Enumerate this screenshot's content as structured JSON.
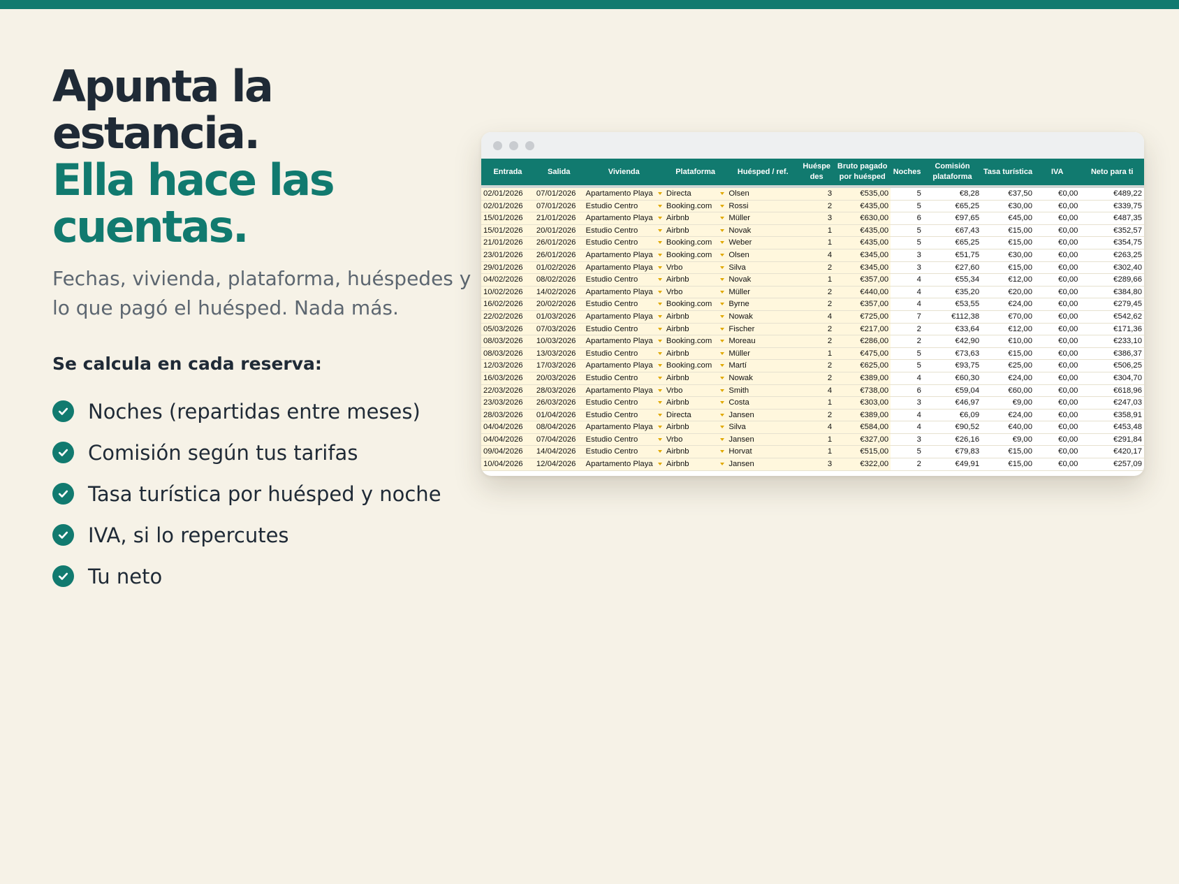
{
  "hero": {
    "title_line1": "Apunta la estancia.",
    "title_line2": "Ella hace las cuentas.",
    "subtitle": "Fechas, vivienda, plataforma, huéspedes y lo que pagó el huésped. Nada más.",
    "calc_title": "Se calcula en cada reserva:",
    "features": [
      "Noches (repartidas entre meses)",
      "Comisión según tus tarifas",
      "Tasa turística por huésped y noche",
      "IVA, si lo repercutes",
      "Tu neto"
    ]
  },
  "colors": {
    "accent": "#117a6f",
    "background": "#f6f2e7",
    "input_cell": "#fff7dd",
    "dropdown_arrow": "#e0a800"
  },
  "icons": {
    "feature_bullet": "check-circle-icon",
    "cell_dropdown": "dropdown-arrow-icon"
  },
  "sheet": {
    "headers": [
      "Entrada",
      "Salida",
      "Vivienda",
      "Plataforma",
      "Huésped / ref.",
      "Huéspe des",
      "Bruto pagado por huésped",
      "Noches",
      "Comisión plataforma",
      "Tasa turística",
      "IVA",
      "Neto para ti"
    ],
    "rows": [
      [
        "02/01/2026",
        "07/01/2026",
        "Apartamento Playa",
        "Directa",
        "Olsen",
        "3",
        "€535,00",
        "5",
        "€8,28",
        "€37,50",
        "€0,00",
        "€489,22"
      ],
      [
        "02/01/2026",
        "07/01/2026",
        "Estudio Centro",
        "Booking.com",
        "Rossi",
        "2",
        "€435,00",
        "5",
        "€65,25",
        "€30,00",
        "€0,00",
        "€339,75"
      ],
      [
        "15/01/2026",
        "21/01/2026",
        "Apartamento Playa",
        "Airbnb",
        "Müller",
        "3",
        "€630,00",
        "6",
        "€97,65",
        "€45,00",
        "€0,00",
        "€487,35"
      ],
      [
        "15/01/2026",
        "20/01/2026",
        "Estudio Centro",
        "Airbnb",
        "Novak",
        "1",
        "€435,00",
        "5",
        "€67,43",
        "€15,00",
        "€0,00",
        "€352,57"
      ],
      [
        "21/01/2026",
        "26/01/2026",
        "Estudio Centro",
        "Booking.com",
        "Weber",
        "1",
        "€435,00",
        "5",
        "€65,25",
        "€15,00",
        "€0,00",
        "€354,75"
      ],
      [
        "23/01/2026",
        "26/01/2026",
        "Apartamento Playa",
        "Booking.com",
        "Olsen",
        "4",
        "€345,00",
        "3",
        "€51,75",
        "€30,00",
        "€0,00",
        "€263,25"
      ],
      [
        "29/01/2026",
        "01/02/2026",
        "Apartamento Playa",
        "Vrbo",
        "Silva",
        "2",
        "€345,00",
        "3",
        "€27,60",
        "€15,00",
        "€0,00",
        "€302,40"
      ],
      [
        "04/02/2026",
        "08/02/2026",
        "Estudio Centro",
        "Airbnb",
        "Novak",
        "1",
        "€357,00",
        "4",
        "€55,34",
        "€12,00",
        "€0,00",
        "€289,66"
      ],
      [
        "10/02/2026",
        "14/02/2026",
        "Apartamento Playa",
        "Vrbo",
        "Müller",
        "2",
        "€440,00",
        "4",
        "€35,20",
        "€20,00",
        "€0,00",
        "€384,80"
      ],
      [
        "16/02/2026",
        "20/02/2026",
        "Estudio Centro",
        "Booking.com",
        "Byrne",
        "2",
        "€357,00",
        "4",
        "€53,55",
        "€24,00",
        "€0,00",
        "€279,45"
      ],
      [
        "22/02/2026",
        "01/03/2026",
        "Apartamento Playa",
        "Airbnb",
        "Nowak",
        "4",
        "€725,00",
        "7",
        "€112,38",
        "€70,00",
        "€0,00",
        "€542,62"
      ],
      [
        "05/03/2026",
        "07/03/2026",
        "Estudio Centro",
        "Airbnb",
        "Fischer",
        "2",
        "€217,00",
        "2",
        "€33,64",
        "€12,00",
        "€0,00",
        "€171,36"
      ],
      [
        "08/03/2026",
        "10/03/2026",
        "Apartamento Playa",
        "Booking.com",
        "Moreau",
        "2",
        "€286,00",
        "2",
        "€42,90",
        "€10,00",
        "€0,00",
        "€233,10"
      ],
      [
        "08/03/2026",
        "13/03/2026",
        "Estudio Centro",
        "Airbnb",
        "Müller",
        "1",
        "€475,00",
        "5",
        "€73,63",
        "€15,00",
        "€0,00",
        "€386,37"
      ],
      [
        "12/03/2026",
        "17/03/2026",
        "Apartamento Playa",
        "Booking.com",
        "Martí",
        "2",
        "€625,00",
        "5",
        "€93,75",
        "€25,00",
        "€0,00",
        "€506,25"
      ],
      [
        "16/03/2026",
        "20/03/2026",
        "Estudio Centro",
        "Airbnb",
        "Nowak",
        "2",
        "€389,00",
        "4",
        "€60,30",
        "€24,00",
        "€0,00",
        "€304,70"
      ],
      [
        "22/03/2026",
        "28/03/2026",
        "Apartamento Playa",
        "Vrbo",
        "Smith",
        "4",
        "€738,00",
        "6",
        "€59,04",
        "€60,00",
        "€0,00",
        "€618,96"
      ],
      [
        "23/03/2026",
        "26/03/2026",
        "Estudio Centro",
        "Airbnb",
        "Costa",
        "1",
        "€303,00",
        "3",
        "€46,97",
        "€9,00",
        "€0,00",
        "€247,03"
      ],
      [
        "28/03/2026",
        "01/04/2026",
        "Estudio Centro",
        "Directa",
        "Jansen",
        "2",
        "€389,00",
        "4",
        "€6,09",
        "€24,00",
        "€0,00",
        "€358,91"
      ],
      [
        "04/04/2026",
        "08/04/2026",
        "Apartamento Playa",
        "Airbnb",
        "Silva",
        "4",
        "€584,00",
        "4",
        "€90,52",
        "€40,00",
        "€0,00",
        "€453,48"
      ],
      [
        "04/04/2026",
        "07/04/2026",
        "Estudio Centro",
        "Vrbo",
        "Jansen",
        "1",
        "€327,00",
        "3",
        "€26,16",
        "€9,00",
        "€0,00",
        "€291,84"
      ],
      [
        "09/04/2026",
        "14/04/2026",
        "Estudio Centro",
        "Airbnb",
        "Horvat",
        "1",
        "€515,00",
        "5",
        "€79,83",
        "€15,00",
        "€0,00",
        "€420,17"
      ],
      [
        "10/04/2026",
        "12/04/2026",
        "Apartamento Playa",
        "Airbnb",
        "Jansen",
        "3",
        "€322,00",
        "2",
        "€49,91",
        "€15,00",
        "€0,00",
        "€257,09"
      ]
    ]
  }
}
